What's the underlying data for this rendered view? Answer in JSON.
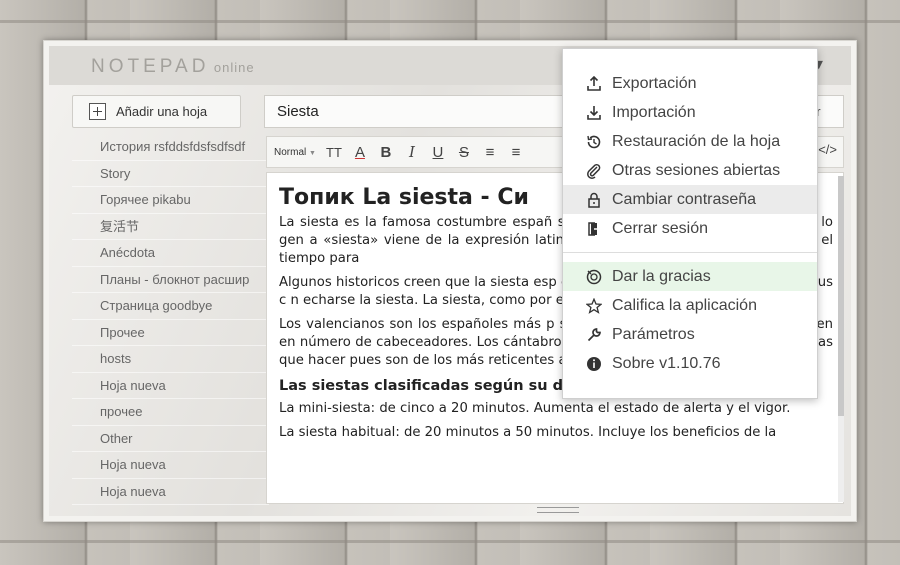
{
  "app": {
    "logo_main": "NOTEPAD",
    "logo_sub": "online"
  },
  "sidebar": {
    "add_sheet_label": "Añadir una hoja",
    "items": [
      "История rsfddsfdsfsdfsdf",
      "Story",
      "Горячее pikabu",
      "复活节",
      "Anécdota",
      "Планы - блокнот расшир",
      "Страница goodbye",
      "Прочее",
      "hosts",
      "Hoja nueva",
      "прочее",
      "Other",
      "Hoja nueva",
      "Hoja nueva"
    ]
  },
  "editor": {
    "title_value": "Siesta",
    "save_fragment": "ar",
    "toolbar": {
      "format_label": "Normal",
      "buttons": [
        "TT",
        "A",
        "B",
        "I",
        "U",
        "S",
        "≡",
        "≡"
      ],
      "source_label": "</>"
    },
    "content": {
      "heading": "Топик La siesta - Си",
      "p1": "La siesta es la famosa costumbre españ                                                  s minutos (entre veinte y treinta), por lo gen                                                 a «siesta» viene de la expresión latina «hor                                                  a entre las 12 y las 15 horas, el tiempo para",
      "p2": "Algunos historicos creen que la siesta esp                                                  o siglos, en el XVII, cuando los reyes, sus c                                                 n echarse la siesta. La siesta, como por eje nacional.",
      "p3": "Los valencianos son los españoles más p                                                  s, Andalucía, Madrid y Aragón les siguen en número de cabeceadores. Los cántabros y catalones deben tener mejores cosas que hacer pues son de los más reticentes al sueño.",
      "subheading": "Las siestas clasificadas según su duración",
      "p4": "La mini-siesta: de cinco a 20 minutos. Aumenta el estado de alerta y el vigor.",
      "p5": "La siesta habitual: de 20 minutos a 50 minutos. Incluye los beneficios de la"
    }
  },
  "menu": {
    "items_top": [
      {
        "label": "Exportación",
        "icon": "export-icon"
      },
      {
        "label": "Importación",
        "icon": "import-icon"
      },
      {
        "label": "Restauración de la hoja",
        "icon": "history-icon"
      },
      {
        "label": "Otras sesiones abiertas",
        "icon": "paperclip-icon"
      },
      {
        "label": "Cambiar contraseña",
        "icon": "lock-icon"
      },
      {
        "label": "Cerrar sesión",
        "icon": "logout-icon"
      }
    ],
    "items_bottom": [
      {
        "label": "Dar la gracias",
        "icon": "thanks-icon"
      },
      {
        "label": "Califica la aplicación",
        "icon": "star-icon"
      },
      {
        "label": "Parámetros",
        "icon": "wrench-icon"
      },
      {
        "label": "Sobre v1.10.76",
        "icon": "info-icon"
      }
    ]
  }
}
